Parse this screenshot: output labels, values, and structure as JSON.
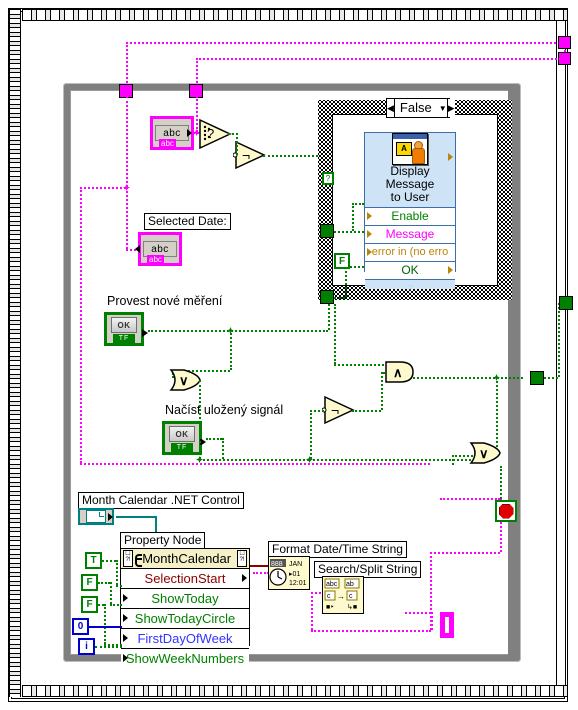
{
  "app": {
    "kind": "labview-block-diagram",
    "language_note": "Czech control labels"
  },
  "colors": {
    "wire_boolean": "#008000",
    "wire_string": "#ff00ff",
    "wire_refnum": "#008080",
    "wire_numeric": "#0000cd",
    "structure_grey": "#808080",
    "subvi_body": "#cfe3f7",
    "primitive_fill": "#fffacd"
  },
  "case_structure": {
    "selector_label": "False",
    "left_arrow": "◀",
    "right_arrow": "▶",
    "dropdown": "▼",
    "name": "case-structure-false"
  },
  "subvi": {
    "title_line1": "Display Message",
    "title_line2": "to User",
    "icon_letter": "A",
    "terminals": [
      {
        "label": "Enable",
        "color": "green"
      },
      {
        "label": "Message",
        "color": "magenta"
      },
      {
        "label": "error in (no erro",
        "color": "olive"
      },
      {
        "label": "OK",
        "color": "dkgreen"
      }
    ]
  },
  "terminals": {
    "string_top": {
      "value": "abc",
      "tag": "abc"
    },
    "selected_date_label": "Selected Date:",
    "selected_date_term": {
      "value": "abc",
      "tag": "abc"
    },
    "output_string_name": "string-indicator"
  },
  "buttons": [
    {
      "label": "Provest nové měření",
      "face": "OK",
      "mech": "TF",
      "name": "boolean-provest-nove-mereni"
    },
    {
      "label": "Načíst uložený signál",
      "face": "OK",
      "mech": "TF",
      "name": "boolean-nacist-ulozeny-signal"
    }
  ],
  "stop_button": {
    "name": "stop-button"
  },
  "refnum": {
    "label": "Month Calendar .NET Control",
    "name": "month-calendar-net-refnum"
  },
  "property_node": {
    "caption": "Property Node",
    "class_name": "MonthCalendar",
    "properties": [
      {
        "label": "SelectionStart",
        "color": "maroon",
        "direction": "read"
      },
      {
        "label": "ShowToday",
        "color": "green",
        "direction": "write"
      },
      {
        "label": "ShowTodayCircle",
        "color": "green",
        "direction": "write"
      },
      {
        "label": "FirstDayOfWeek",
        "color": "blue",
        "direction": "write"
      },
      {
        "label": "ShowWeekNumbers",
        "color": "green",
        "direction": "write"
      }
    ]
  },
  "constants": [
    {
      "value": "T",
      "type": "boolean",
      "name": "constant-true"
    },
    {
      "value": "F",
      "type": "boolean",
      "name": "constant-false-1"
    },
    {
      "value": "F",
      "type": "boolean",
      "name": "constant-false-2"
    },
    {
      "value": "0",
      "type": "numeric",
      "name": "constant-zero"
    },
    {
      "value": "i",
      "type": "numeric",
      "name": "constant-i"
    }
  ],
  "nodes": {
    "format_datetime_label": "Format Date/Time String",
    "search_split_label": "Search/Split String",
    "empty_string_path": "empty-string-path-primitive",
    "not_1": "not-primitive-1",
    "not_2": "not-primitive-2",
    "or_1": "or-primitive-1",
    "and_1": "and-primitive",
    "or_2": "or-primitive-2"
  },
  "glyphs": {
    "and": "∧",
    "or": "∨",
    "not": "¬",
    "jan": "JAN",
    "day": "01",
    "time": "12:01"
  }
}
